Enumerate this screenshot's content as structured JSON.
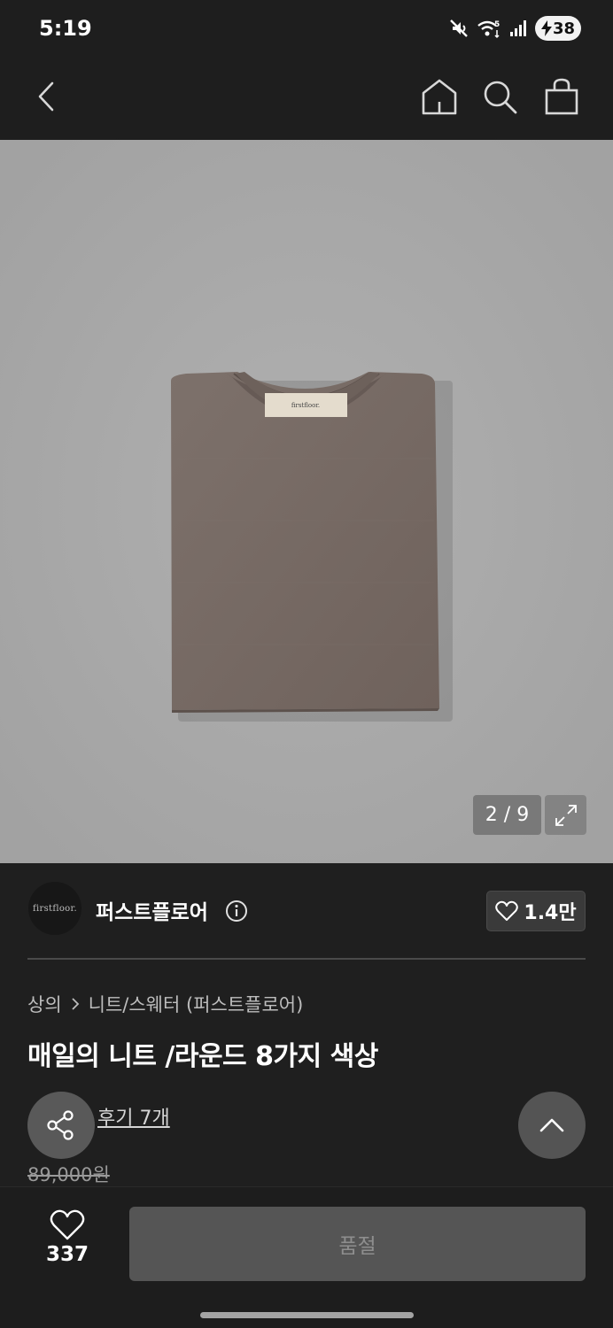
{
  "status_bar": {
    "time": "5:19",
    "battery": "38"
  },
  "nav": {
    "icons": [
      "back-icon",
      "home-icon",
      "search-icon",
      "shopping-bag-icon"
    ]
  },
  "gallery": {
    "counter": "2 / 9",
    "label_text": "first floor"
  },
  "brand": {
    "logo_text": "firstfloor.",
    "name": "퍼스트플로어",
    "like_count": "1.4만"
  },
  "product": {
    "breadcrumb": [
      "상의",
      "니트/스웨터 (퍼스트플로어)"
    ],
    "title": "매일의 니트 /라운드 8가지 색상",
    "review_link": "후기 7개",
    "original_price": "89,000원"
  },
  "bottom": {
    "wish_count": "337",
    "sold_out_label": "품절"
  }
}
